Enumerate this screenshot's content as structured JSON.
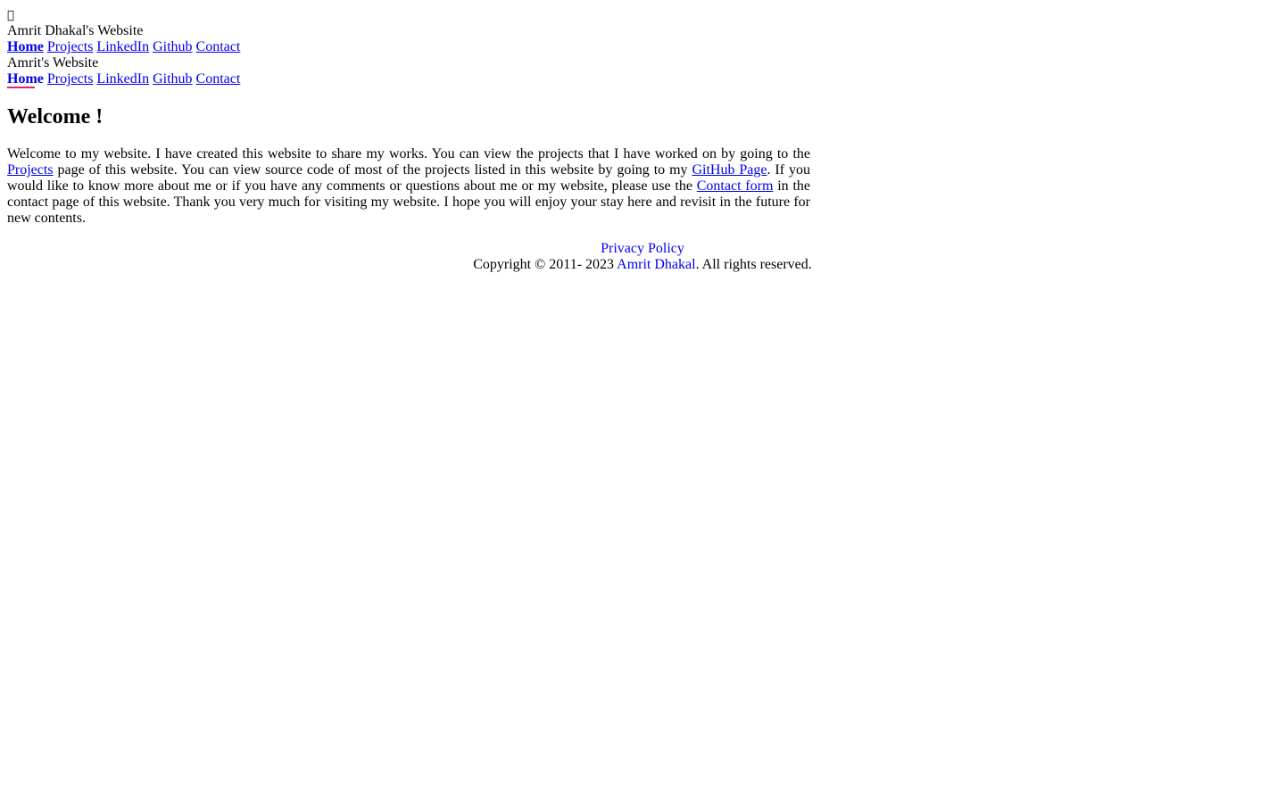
{
  "menu": {
    "icon": "menu-icon"
  },
  "header": {
    "title": "Amrit Dhakal's Website",
    "nav": [
      {
        "label": "Home",
        "active": true
      },
      {
        "label": "Projects"
      },
      {
        "label": "LinkedIn"
      },
      {
        "label": "Github"
      },
      {
        "label": "Contact"
      }
    ]
  },
  "header2": {
    "title": "Amrit's Website",
    "nav": [
      {
        "label": "Home",
        "active": true
      },
      {
        "label": "Projects"
      },
      {
        "label": "LinkedIn"
      },
      {
        "label": "Github"
      },
      {
        "label": "Contact"
      }
    ]
  },
  "main": {
    "heading": "Welcome !",
    "paragraph": {
      "part1": "Welcome to my website. I have created this website to share my works. You can view the projects that I have worked on by going to the ",
      "link1": "Projects",
      "part2": " page of this website. You can view source code of most of the projects listed in this website by going to my ",
      "link2": "GitHub Page",
      "part3": ". If you would like to know more about me or if you have any comments or questions about me or my website, please use the ",
      "link3": "Contact form",
      "part4": " in the contact page of this website. Thank you very much for visiting my website. I hope you will enjoy your stay here and revisit in the future for new contents."
    }
  },
  "footer": {
    "privacy": "Privacy Policy",
    "copyright_prefix": "Copyright © 2011- 2023 ",
    "author": "Amrit Dhakal",
    "copyright_suffix": ". All rights reserved."
  }
}
